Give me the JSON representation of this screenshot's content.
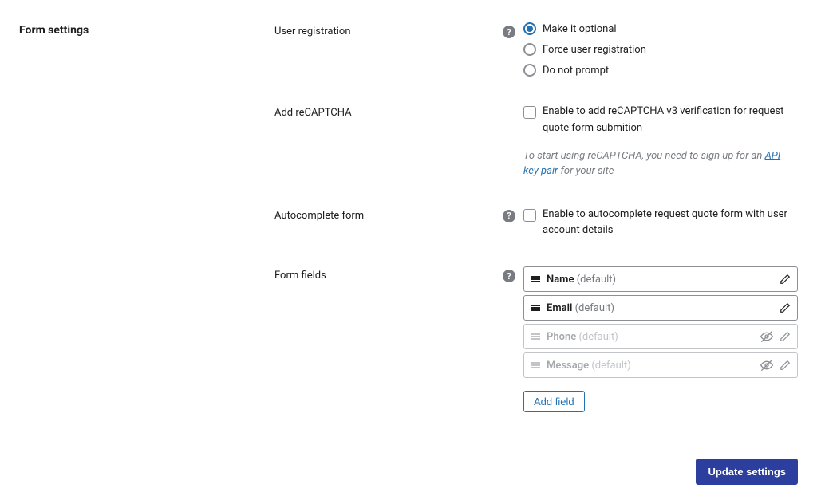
{
  "section_title": "Form settings",
  "rows": {
    "user_registration": {
      "label": "User registration",
      "options": {
        "optional": "Make it optional",
        "force": "Force user registration",
        "none": "Do not prompt"
      }
    },
    "recaptcha": {
      "label": "Add reCAPTCHA",
      "checkbox_label": "Enable to add reCAPTCHA v3 verification for request quote form submition",
      "hint_prefix": "To start using reCAPTCHA, you need to sign up for an ",
      "hint_link": "API key pair",
      "hint_suffix": " for your site"
    },
    "autocomplete": {
      "label": "Autocomplete form",
      "checkbox_label": "Enable to autocomplete request quote form with user account details"
    },
    "form_fields": {
      "label": "Form fields",
      "fields": [
        {
          "name": "Name",
          "suffix": "(default)",
          "enabled": true
        },
        {
          "name": "Email",
          "suffix": "(default)",
          "enabled": true
        },
        {
          "name": "Phone",
          "suffix": "(default)",
          "enabled": false
        },
        {
          "name": "Message",
          "suffix": "(default)",
          "enabled": false
        }
      ],
      "add_button": "Add field"
    }
  },
  "footer": {
    "update_button": "Update settings"
  }
}
